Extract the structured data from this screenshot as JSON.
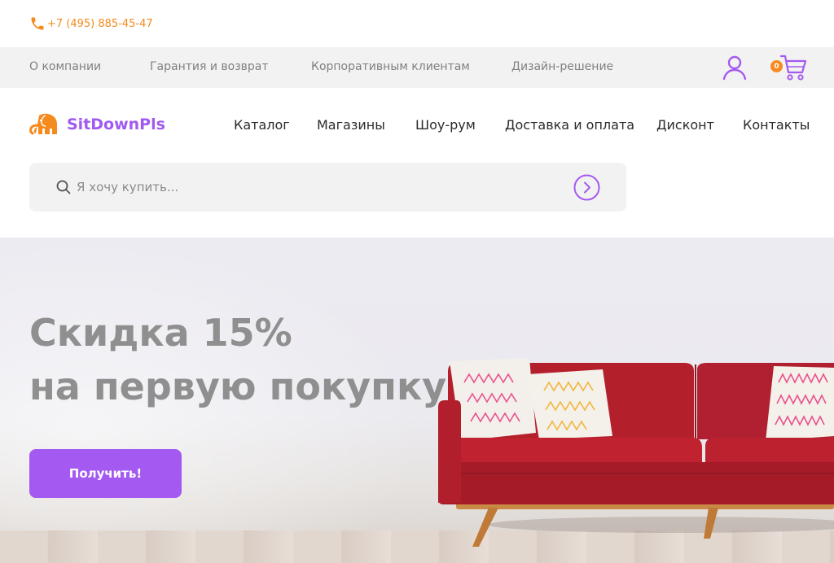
{
  "topbar": {
    "phone": "+7 (495) 885-45-47"
  },
  "info_nav": {
    "items": [
      {
        "label": "О компании"
      },
      {
        "label": "Гарантия и возврат"
      },
      {
        "label": "Корпоративным клиентам"
      },
      {
        "label": "Дизайн-решение"
      }
    ],
    "cart_count": "0"
  },
  "header": {
    "logo_text": "SitDownPls",
    "nav": [
      {
        "label": "Каталог"
      },
      {
        "label": "Магазины"
      },
      {
        "label": "Шоу-рум"
      },
      {
        "label": "Доставка и оплата"
      },
      {
        "label": "Дисконт"
      },
      {
        "label": "Контакты"
      }
    ]
  },
  "search": {
    "placeholder": "Я хочу купить..."
  },
  "hero": {
    "line1": "Скидка 15%",
    "line2": "на первую покупку",
    "button": "Получить!"
  },
  "icons": {
    "phone": "phone-icon",
    "user": "user-icon",
    "cart": "cart-icon",
    "search": "search-icon",
    "go": "chevron-right-icon",
    "logo": "elephant-icon"
  },
  "colors": {
    "accent": "#a45af0",
    "orange": "#f58a1f",
    "infobar": "#f2f2f2"
  }
}
